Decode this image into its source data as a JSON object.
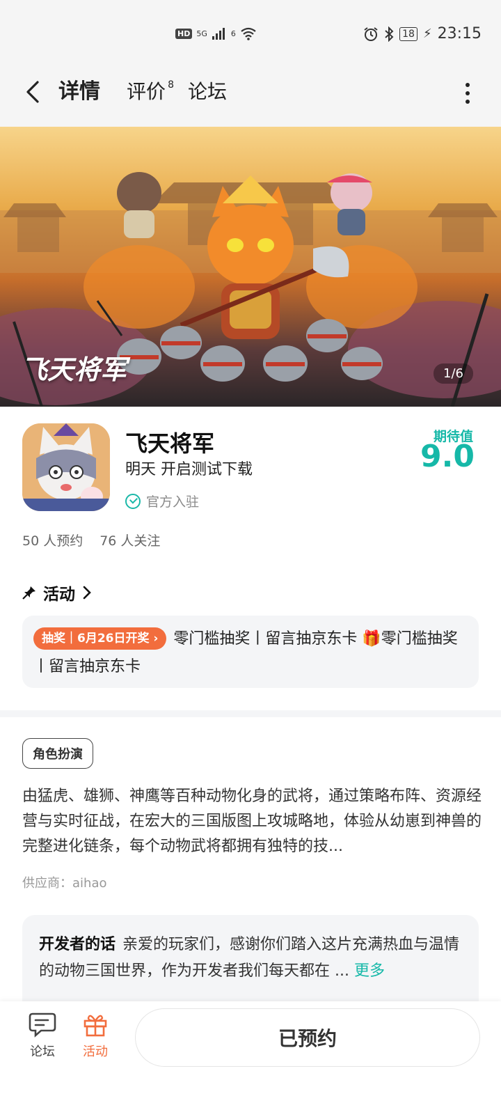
{
  "status_bar": {
    "hd": "HD",
    "network": "5G",
    "wifi_gen": "6",
    "battery": "18",
    "time": "23:15"
  },
  "nav": {
    "tabs": [
      {
        "label": "详情",
        "active": true
      },
      {
        "label": "评价",
        "badge": "8"
      },
      {
        "label": "论坛"
      }
    ]
  },
  "banner": {
    "logo_text": "飞天将军",
    "counter": "1/6"
  },
  "app": {
    "name": "飞天将军",
    "subtitle": "明天 开启测试下载",
    "official_label": "官方入驻",
    "expect_label": "期待值",
    "expect_value": "9.0",
    "reservations": "50 人预约",
    "followers": "76 人关注"
  },
  "activity": {
    "title": "活动",
    "badge": "抽奖｜6月26日开奖 ›",
    "text": "零门槛抽奖丨留言抽京东卡 🎁零门槛抽奖丨留言抽京东卡"
  },
  "description": {
    "tag": "角色扮演",
    "text": "由猛虎、雄狮、神鹰等百种动物化身的武将，通过策略布阵、资源经营与实时征战，在宏大的三国版图上攻城略地，体验从幼崽到神兽的完整进化链条，每个动物武将都拥有独特的技...",
    "vendor": "供应商：aihao"
  },
  "developer": {
    "label": "开发者的话",
    "text": "亲爱的玩家们，感谢你们踏入这片充满热血与温情的动物三国世界，作为开发者我们每天都在 ...",
    "more": "更多"
  },
  "bottom": {
    "forum_label": "论坛",
    "activity_label": "活动",
    "reserve_label": "已预约"
  },
  "colors": {
    "accent": "#16b8a8",
    "activity": "#f26d3d"
  }
}
